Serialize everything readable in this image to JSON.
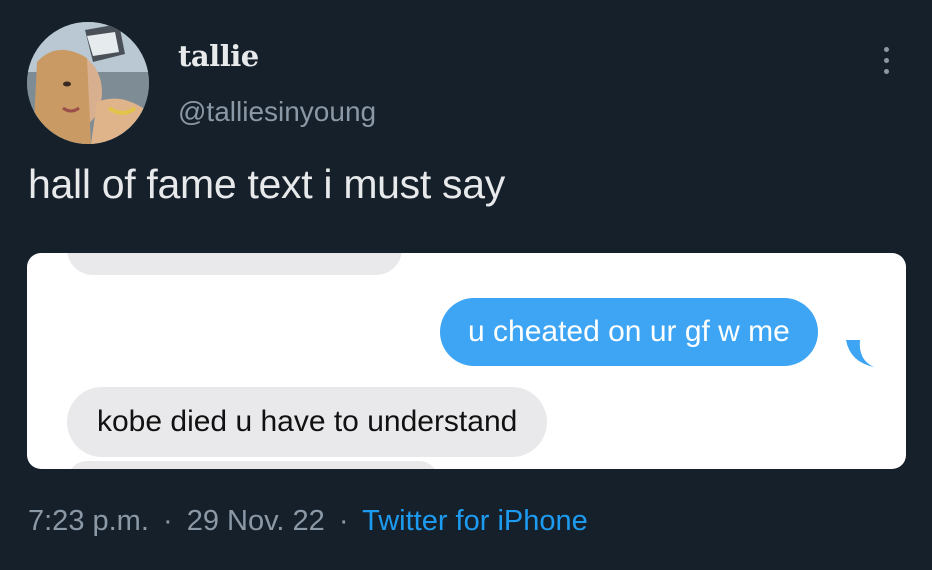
{
  "tweet": {
    "author": {
      "display_name": "tallie",
      "handle": "@talliesinyoung"
    },
    "text": "hall of fame text i must say",
    "time": "7:23 p.m.",
    "date": "29 Nov. 22",
    "separator": "·",
    "source": "Twitter for iPhone"
  },
  "media": {
    "messages": [
      {
        "direction": "sent",
        "text": "u cheated on ur gf w me"
      },
      {
        "direction": "received",
        "text": "kobe died u have to understand"
      }
    ]
  },
  "colors": {
    "background": "#15202b",
    "sent_bubble": "#3da5f4",
    "received_bubble": "#e9e9eb",
    "link": "#1d9bf0",
    "secondary_text": "#8b98a5"
  },
  "icons": {
    "more": "more-options-icon"
  }
}
